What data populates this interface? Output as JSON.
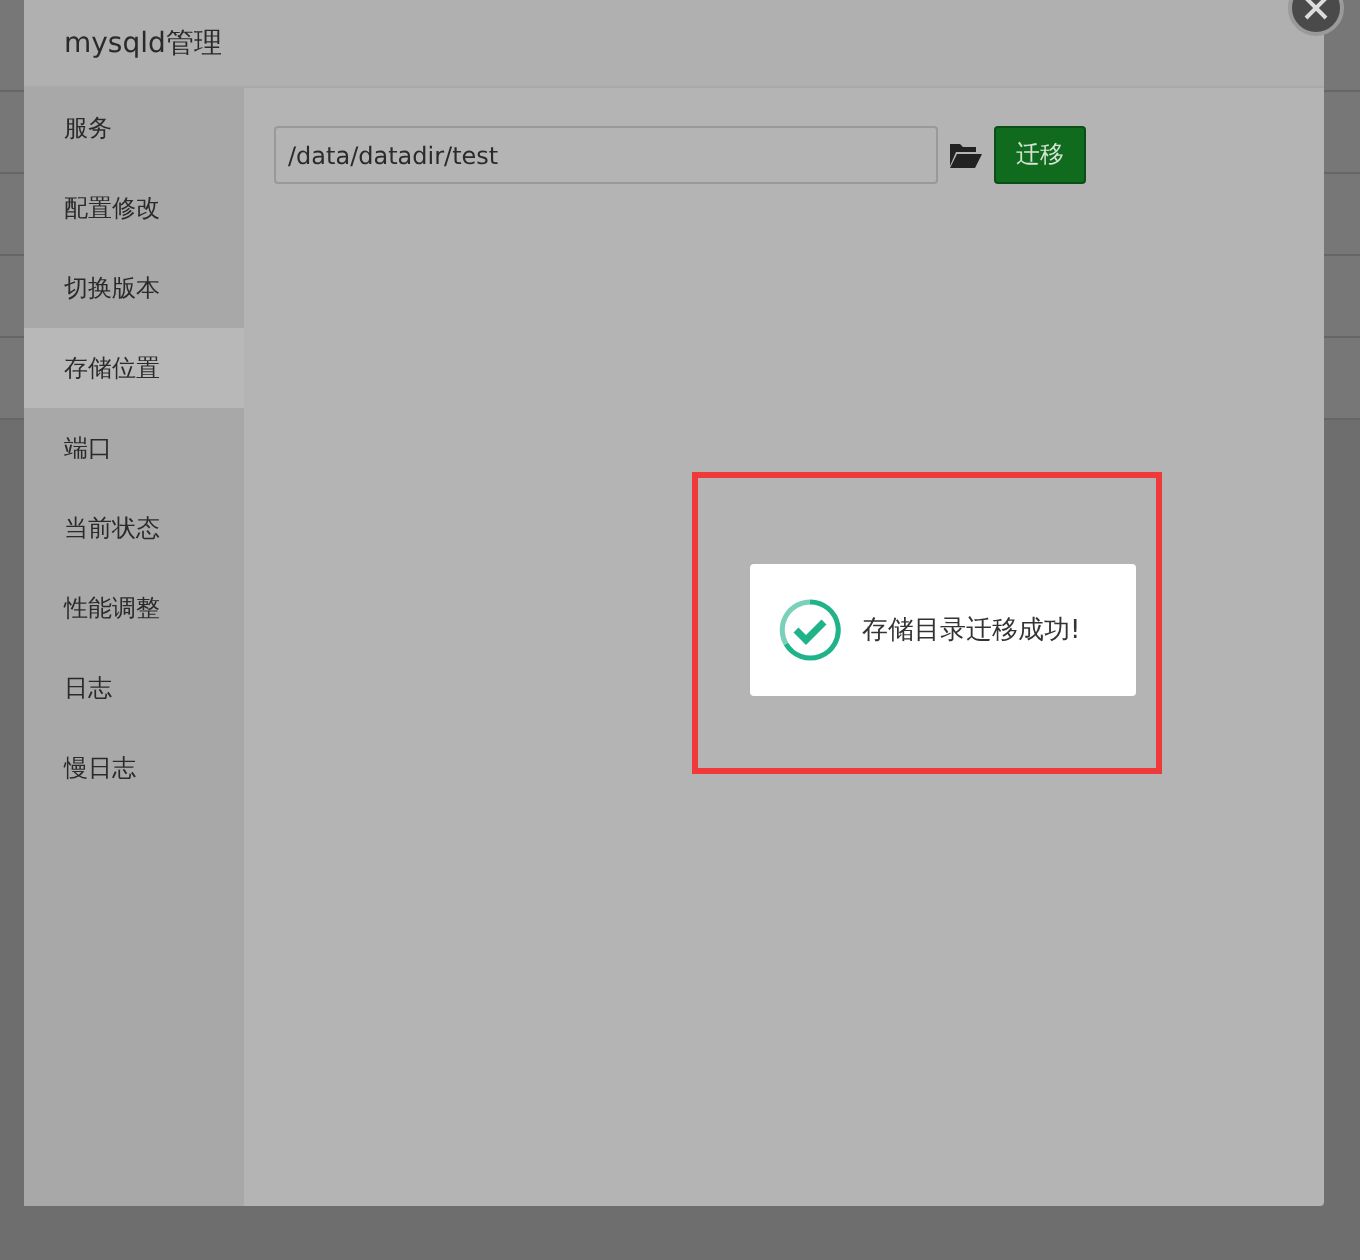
{
  "dialog": {
    "title": "mysqld管理"
  },
  "menu": [
    {
      "label": "服务",
      "selected": false
    },
    {
      "label": "配置修改",
      "selected": false
    },
    {
      "label": "切换版本",
      "selected": false
    },
    {
      "label": "存储位置",
      "selected": true
    },
    {
      "label": "端口",
      "selected": false
    },
    {
      "label": "当前状态",
      "selected": false
    },
    {
      "label": "性能调整",
      "selected": false
    },
    {
      "label": "日志",
      "selected": false
    },
    {
      "label": "慢日志",
      "selected": false
    }
  ],
  "path_field": {
    "value": "/data/datadir/test"
  },
  "migrate_button": {
    "label": "迁移"
  },
  "toast": {
    "message": "存储目录迁移成功!"
  }
}
